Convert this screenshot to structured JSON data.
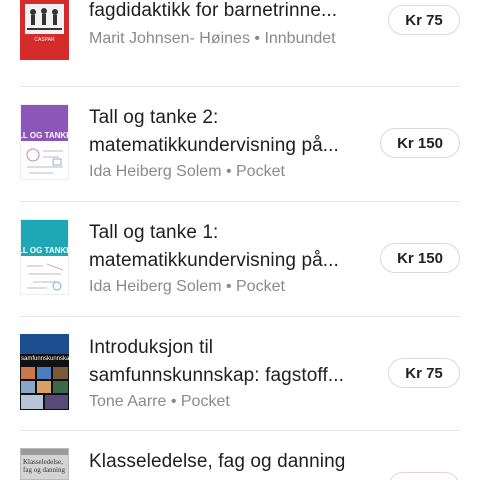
{
  "items": [
    {
      "title_lines": [
        "fagdidaktikk for barnetrinne..."
      ],
      "meta": "Marit Johnsen- Høines • Innbundet",
      "price": "Kr 75",
      "cover_colors": {
        "bg": "#d62b2b",
        "panel": "#f2f2f2"
      },
      "cover_text": "CASPAR"
    },
    {
      "title_lines": [
        "Tall og tanke 2:",
        "matematikkundervisning på..."
      ],
      "meta": "Ida Heiberg Solem • Pocket",
      "price": "Kr 150",
      "cover_colors": {
        "bg": "#8b56b8",
        "panel": "#ffffff"
      },
      "cover_text": "LL OG TANKE"
    },
    {
      "title_lines": [
        "Tall og tanke 1:",
        "matematikkundervisning på..."
      ],
      "meta": "Ida Heiberg Solem • Pocket",
      "price": "Kr 150",
      "cover_colors": {
        "bg": "#1ea7b5",
        "panel": "#ffffff"
      },
      "cover_text": "LL OG TANKE"
    },
    {
      "title_lines": [
        "Introduksjon til",
        "samfunnskunnskap: fagstoff..."
      ],
      "meta": "Tone Aarre • Pocket",
      "price": "Kr 75",
      "cover_colors": {
        "bg": "#1d4e8f",
        "panel": "#111111"
      },
      "cover_text": "samfunnskunnskap"
    },
    {
      "title_lines": [
        "Klasseledelse, fag og danning"
      ],
      "meta": "",
      "price": "",
      "cover_colors": {
        "bg": "#9a9a9a",
        "panel": "#cfcfcf"
      },
      "cover_text": "Klasseledelse, fag og danning"
    }
  ]
}
